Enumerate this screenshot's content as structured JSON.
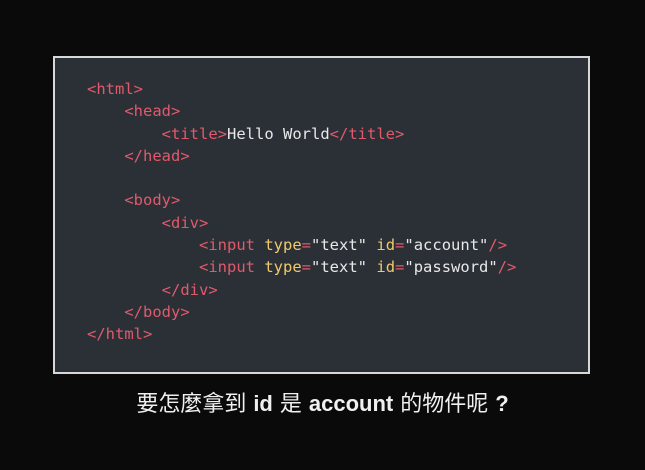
{
  "code_lines": [
    [
      {
        "t": "<",
        "k": "bracket"
      },
      {
        "t": "html",
        "k": "tag"
      },
      {
        "t": ">",
        "k": "bracket"
      }
    ],
    [
      {
        "t": "    ",
        "k": "text"
      },
      {
        "t": "<",
        "k": "bracket"
      },
      {
        "t": "head",
        "k": "tag"
      },
      {
        "t": ">",
        "k": "bracket"
      }
    ],
    [
      {
        "t": "        ",
        "k": "text"
      },
      {
        "t": "<",
        "k": "bracket"
      },
      {
        "t": "title",
        "k": "tag"
      },
      {
        "t": ">",
        "k": "bracket"
      },
      {
        "t": "Hello World",
        "k": "text"
      },
      {
        "t": "</",
        "k": "bracket"
      },
      {
        "t": "title",
        "k": "tag"
      },
      {
        "t": ">",
        "k": "bracket"
      }
    ],
    [
      {
        "t": "    ",
        "k": "text"
      },
      {
        "t": "</",
        "k": "bracket"
      },
      {
        "t": "head",
        "k": "tag"
      },
      {
        "t": ">",
        "k": "bracket"
      }
    ],
    [],
    [
      {
        "t": "    ",
        "k": "text"
      },
      {
        "t": "<",
        "k": "bracket"
      },
      {
        "t": "body",
        "k": "tag"
      },
      {
        "t": ">",
        "k": "bracket"
      }
    ],
    [
      {
        "t": "        ",
        "k": "text"
      },
      {
        "t": "<",
        "k": "bracket"
      },
      {
        "t": "div",
        "k": "tag"
      },
      {
        "t": ">",
        "k": "bracket"
      }
    ],
    [
      {
        "t": "            ",
        "k": "text"
      },
      {
        "t": "<",
        "k": "bracket"
      },
      {
        "t": "input",
        "k": "tag"
      },
      {
        "t": " ",
        "k": "text"
      },
      {
        "t": "type",
        "k": "attr"
      },
      {
        "t": "=",
        "k": "bracket"
      },
      {
        "t": "\"text\"",
        "k": "value"
      },
      {
        "t": " ",
        "k": "text"
      },
      {
        "t": "id",
        "k": "attr"
      },
      {
        "t": "=",
        "k": "bracket"
      },
      {
        "t": "\"account\"",
        "k": "value"
      },
      {
        "t": "/>",
        "k": "bracket"
      }
    ],
    [
      {
        "t": "            ",
        "k": "text"
      },
      {
        "t": "<",
        "k": "bracket"
      },
      {
        "t": "input",
        "k": "tag"
      },
      {
        "t": " ",
        "k": "text"
      },
      {
        "t": "type",
        "k": "attr"
      },
      {
        "t": "=",
        "k": "bracket"
      },
      {
        "t": "\"text\"",
        "k": "value"
      },
      {
        "t": " ",
        "k": "text"
      },
      {
        "t": "id",
        "k": "attr"
      },
      {
        "t": "=",
        "k": "bracket"
      },
      {
        "t": "\"password\"",
        "k": "value"
      },
      {
        "t": "/>",
        "k": "bracket"
      }
    ],
    [
      {
        "t": "        ",
        "k": "text"
      },
      {
        "t": "</",
        "k": "bracket"
      },
      {
        "t": "div",
        "k": "tag"
      },
      {
        "t": ">",
        "k": "bracket"
      }
    ],
    [
      {
        "t": "    ",
        "k": "text"
      },
      {
        "t": "</",
        "k": "bracket"
      },
      {
        "t": "body",
        "k": "tag"
      },
      {
        "t": ">",
        "k": "bracket"
      }
    ],
    [
      {
        "t": "</",
        "k": "bracket"
      },
      {
        "t": "html",
        "k": "tag"
      },
      {
        "t": ">",
        "k": "bracket"
      }
    ]
  ],
  "caption": {
    "part1": "要怎麼拿到 ",
    "part2": "id",
    "part3": " 是 ",
    "part4": "account",
    "part5": " 的物件呢 ",
    "part6": "?"
  },
  "colors": {
    "tag": "#e05a6b",
    "attr": "#f0c96b",
    "text": "#e8e8e8",
    "background": "#2b3037",
    "page": "#0a0a0a"
  }
}
